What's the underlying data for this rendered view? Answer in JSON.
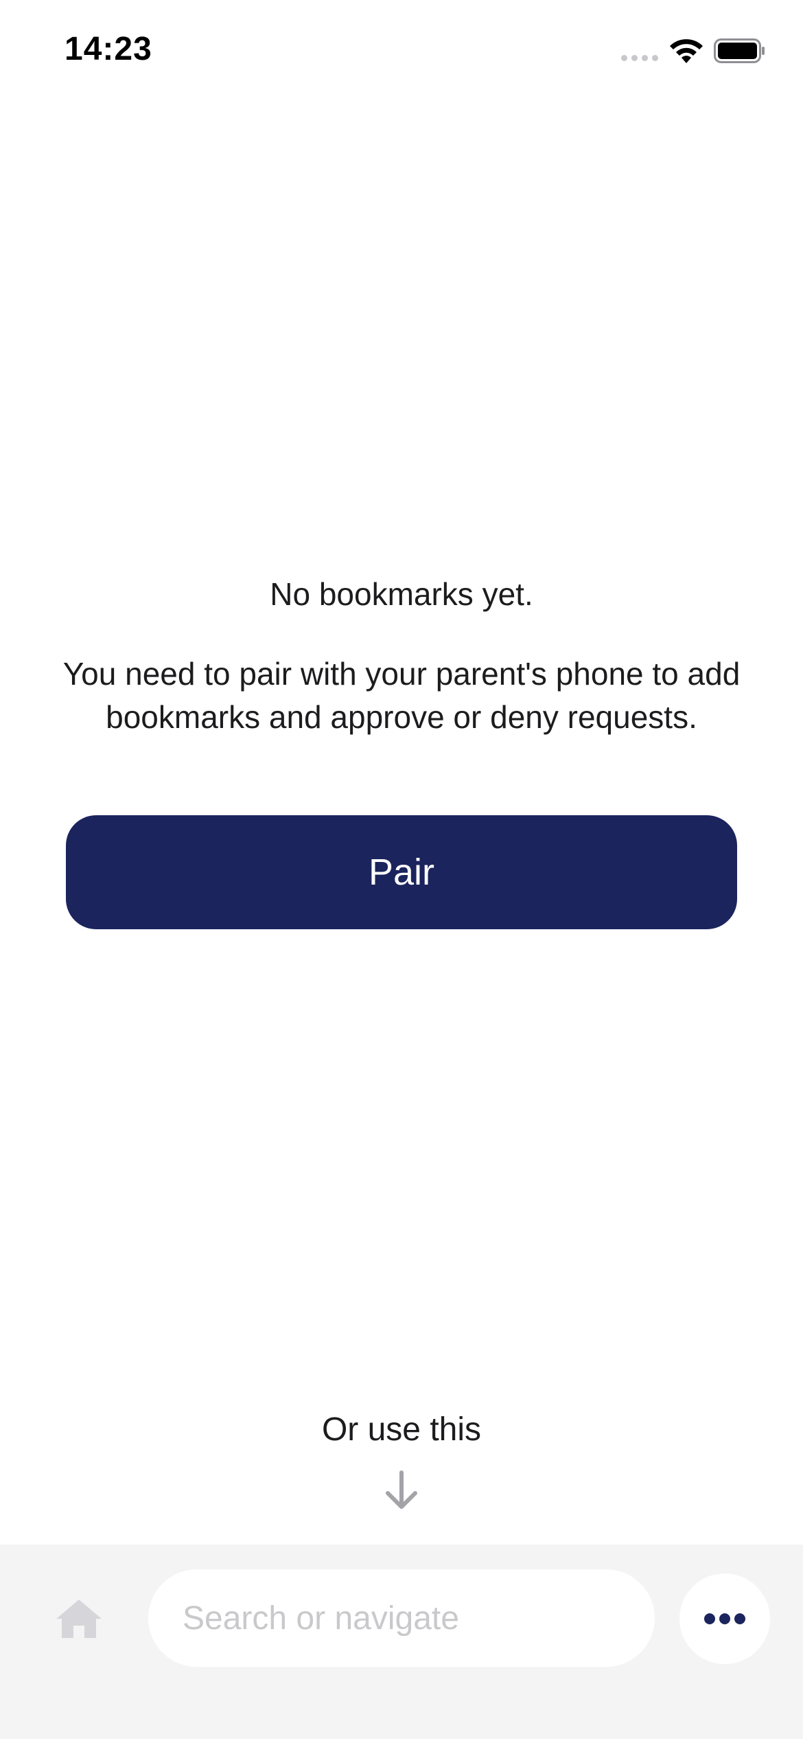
{
  "status_bar": {
    "time": "14:23",
    "icons": [
      "signal-dots-icon",
      "wifi-icon",
      "battery-icon"
    ]
  },
  "empty_state": {
    "title": "No bookmarks yet.",
    "description": "You need to pair with your parent's phone to add bookmarks and approve or deny requests.",
    "pair_button_label": "Pair"
  },
  "hint": {
    "label": "Or use this",
    "icon": "arrow-down-icon"
  },
  "bottom_bar": {
    "home_icon": "home-icon",
    "search_placeholder": "Search or navigate",
    "search_value": "",
    "more_icon": "more-dots-icon"
  },
  "colors": {
    "accent": "#1b245c",
    "background": "#ffffff",
    "bottom_bar_bg": "#f4f4f4",
    "placeholder": "#c9c9cc"
  }
}
